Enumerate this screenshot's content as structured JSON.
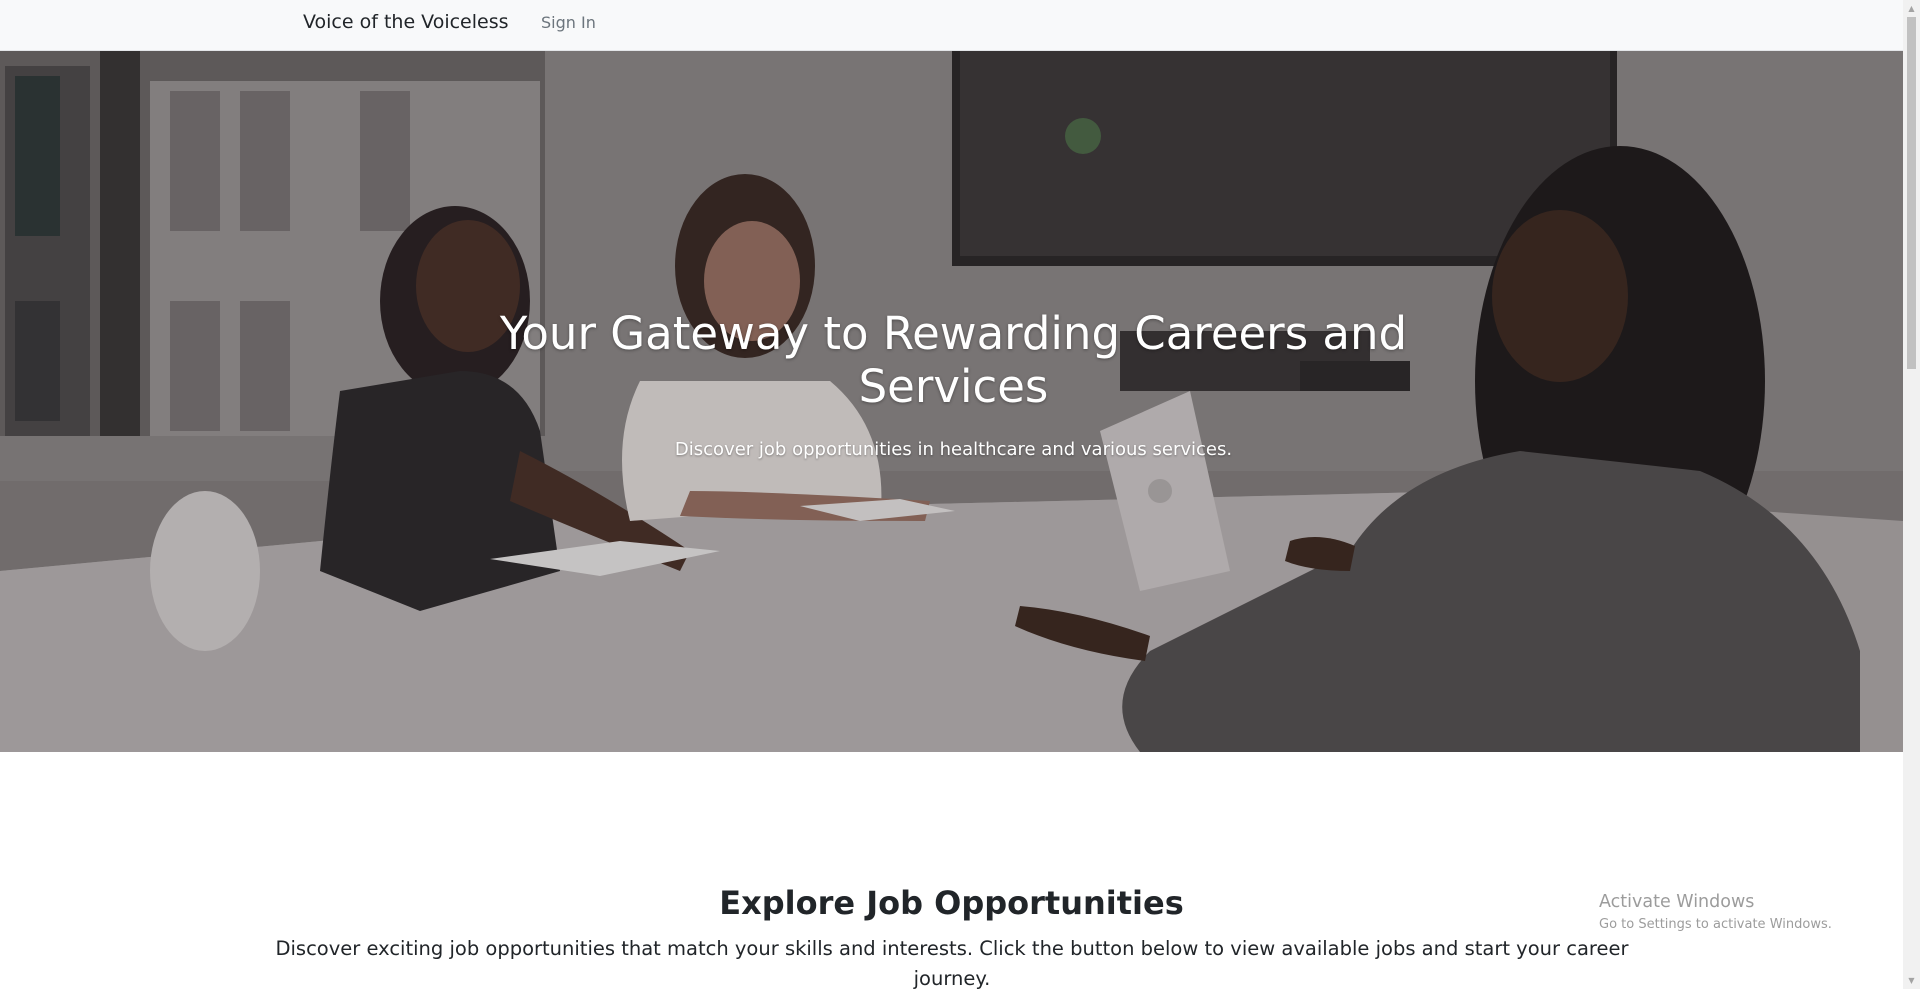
{
  "navbar": {
    "brand": "Voice of the Voiceless",
    "sign_in": "Sign In"
  },
  "hero": {
    "title": "Your Gateway to Rewarding Careers and Services",
    "subtitle": "Discover job opportunities in healthcare and various services."
  },
  "jobs_section": {
    "title": "Explore Job Opportunities",
    "description": "Discover exciting job opportunities that match your skills and interests. Click the button below to view available jobs and start your career journey."
  },
  "watermark": {
    "title": "Activate Windows",
    "subtitle": "Go to Settings to activate Windows."
  },
  "colors": {
    "navbar_bg": "#f8f9fa",
    "text_primary": "#212529",
    "nav_link": "#6c757d",
    "hero_text": "#ffffff"
  }
}
